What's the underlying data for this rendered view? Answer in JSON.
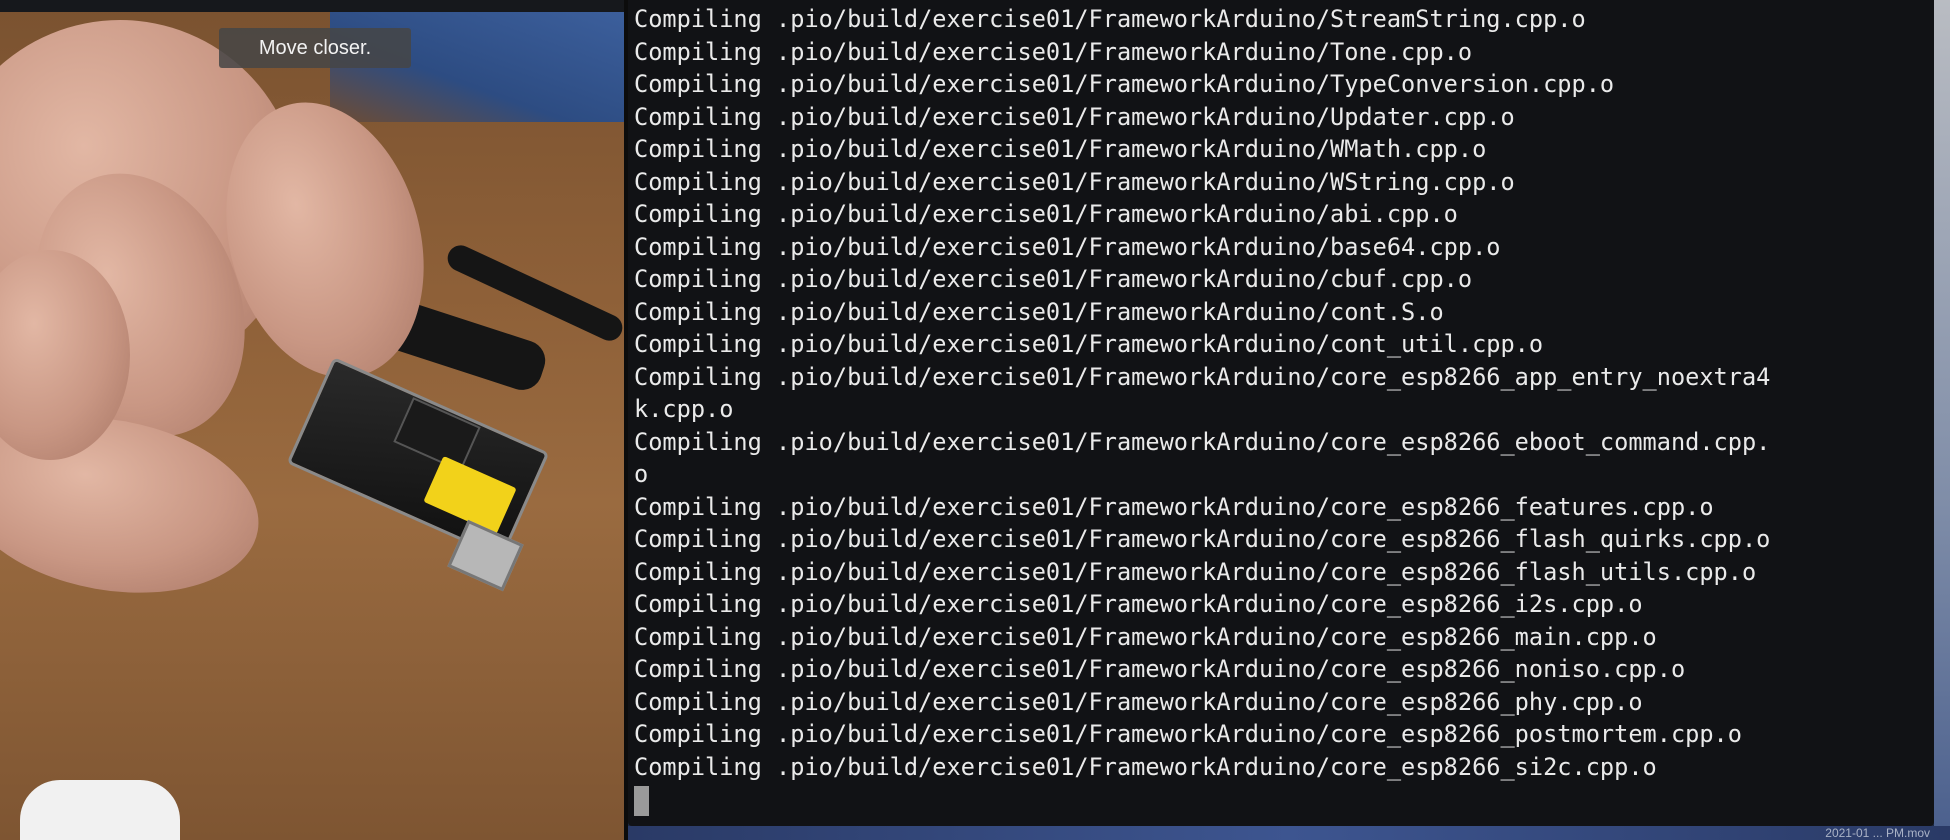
{
  "camera": {
    "hint": "Move closer."
  },
  "terminal": {
    "lines": [
      "Compiling .pio/build/exercise01/FrameworkArduino/StreamString.cpp.o",
      "Compiling .pio/build/exercise01/FrameworkArduino/Tone.cpp.o",
      "Compiling .pio/build/exercise01/FrameworkArduino/TypeConversion.cpp.o",
      "Compiling .pio/build/exercise01/FrameworkArduino/Updater.cpp.o",
      "Compiling .pio/build/exercise01/FrameworkArduino/WMath.cpp.o",
      "Compiling .pio/build/exercise01/FrameworkArduino/WString.cpp.o",
      "Compiling .pio/build/exercise01/FrameworkArduino/abi.cpp.o",
      "Compiling .pio/build/exercise01/FrameworkArduino/base64.cpp.o",
      "Compiling .pio/build/exercise01/FrameworkArduino/cbuf.cpp.o",
      "Compiling .pio/build/exercise01/FrameworkArduino/cont.S.o",
      "Compiling .pio/build/exercise01/FrameworkArduino/cont_util.cpp.o",
      "Compiling .pio/build/exercise01/FrameworkArduino/core_esp8266_app_entry_noextra4",
      "k.cpp.o",
      "Compiling .pio/build/exercise01/FrameworkArduino/core_esp8266_eboot_command.cpp.",
      "o",
      "Compiling .pio/build/exercise01/FrameworkArduino/core_esp8266_features.cpp.o",
      "Compiling .pio/build/exercise01/FrameworkArduino/core_esp8266_flash_quirks.cpp.o",
      "Compiling .pio/build/exercise01/FrameworkArduino/core_esp8266_flash_utils.cpp.o",
      "Compiling .pio/build/exercise01/FrameworkArduino/core_esp8266_i2s.cpp.o",
      "Compiling .pio/build/exercise01/FrameworkArduino/core_esp8266_main.cpp.o",
      "Compiling .pio/build/exercise01/FrameworkArduino/core_esp8266_noniso.cpp.o",
      "Compiling .pio/build/exercise01/FrameworkArduino/core_esp8266_phy.cpp.o",
      "Compiling .pio/build/exercise01/FrameworkArduino/core_esp8266_postmortem.cpp.o",
      "Compiling .pio/build/exercise01/FrameworkArduino/core_esp8266_si2c.cpp.o"
    ]
  },
  "desktop": {
    "caption": "2021-01 ... PM.mov"
  }
}
